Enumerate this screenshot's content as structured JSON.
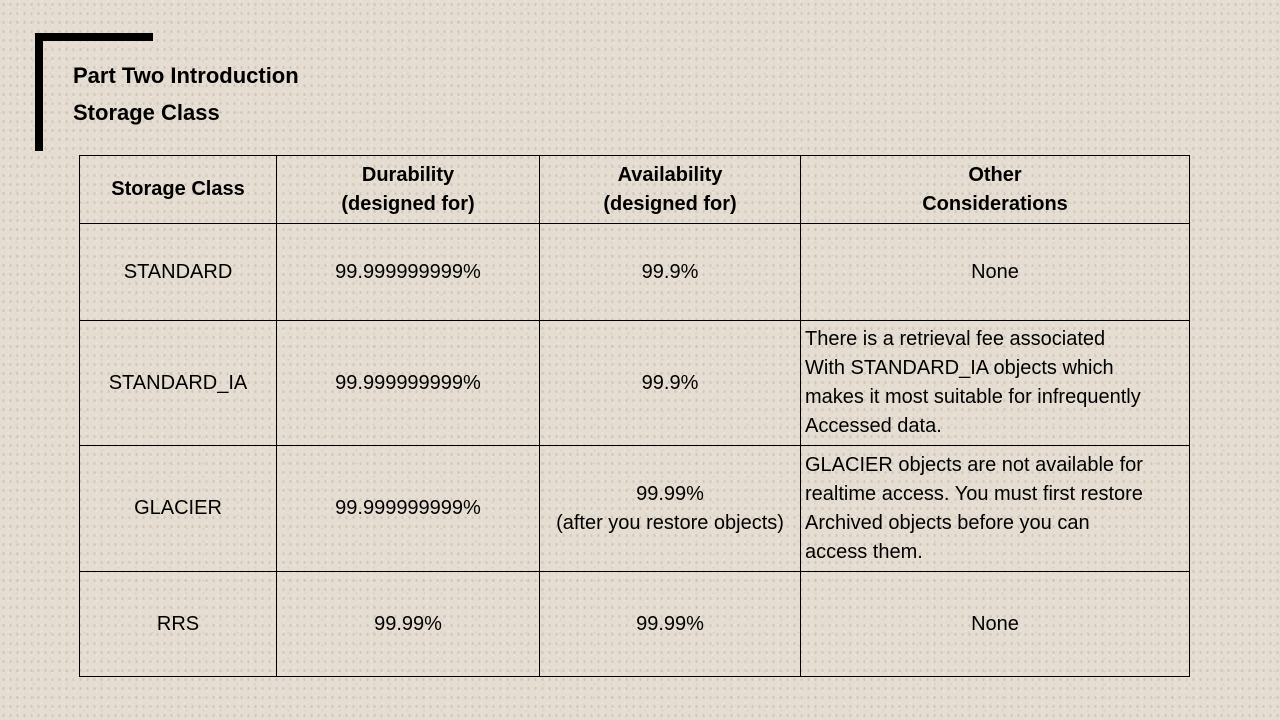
{
  "slide": {
    "title_lines": [
      "Part Two Introduction",
      "Storage Class"
    ]
  },
  "table": {
    "headers": [
      [
        "Storage Class"
      ],
      [
        "Durability",
        "(designed for)"
      ],
      [
        "Availability",
        "(designed for)"
      ],
      [
        "Other",
        "Considerations"
      ]
    ],
    "rows": [
      {
        "storage_class": "STANDARD",
        "durability": "99.999999999%",
        "availability": [
          "99.9%"
        ],
        "other": [
          "None"
        ]
      },
      {
        "storage_class": "STANDARD_IA",
        "durability": "99.999999999%",
        "availability": [
          "99.9%"
        ],
        "other": [
          "There is a retrieval fee associated",
          "With STANDARD_IA objects which",
          "makes it most suitable for infrequently",
          "Accessed data."
        ]
      },
      {
        "storage_class": "GLACIER",
        "durability": "99.999999999%",
        "availability": [
          "99.99%",
          "(after you restore objects)"
        ],
        "other": [
          "GLACIER objects are not available for",
          "realtime access. You must first restore",
          "Archived objects before you can",
          "access them."
        ]
      },
      {
        "storage_class": "RRS",
        "durability": "99.99%",
        "availability": [
          "99.99%"
        ],
        "other": [
          "None"
        ]
      }
    ]
  }
}
